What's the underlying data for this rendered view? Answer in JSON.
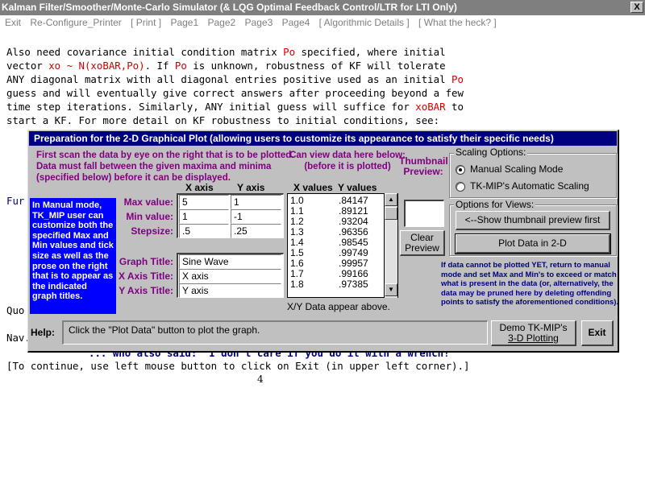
{
  "window": {
    "title": "Kalman Filter/Smoother/Monte-Carlo Simulator (& LQG Optimal Feedback Control/LTR for LTI Only)",
    "close_glyph": "X"
  },
  "menu": {
    "items": [
      "Exit",
      "Re-Configure_Printer",
      "[ Print ]",
      "Page1",
      "Page2",
      "Page3",
      "Page4",
      "[ Algorithmic Details ]",
      "[ What the heck? ]"
    ]
  },
  "document": {
    "line1a": "Also need covariance initial condition matrix ",
    "line1b": "Po",
    "line1c": " specified, where initial",
    "line2a": "vector ",
    "line2b": "xo ~ N(xoBAR,Po)",
    "line2c": ". If ",
    "line2d": "Po",
    "line2e": " is unknown, robustness of KF will tolerate",
    "line3": "ANY diagonal matrix with all diagonal entries positive used as an initial ",
    "line3b": "Po",
    "line4": "guess and will eventually give correct answers after proceeding beyond a few",
    "line5a": "time step iterations. Similarly, ANY initial guess will suffice for ",
    "line5b": "xoBAR",
    "line5c": " to",
    "line6": "start a KF. For more detail on KF robustness to initial conditions, see:",
    "frag_fur": "Fur",
    "frag_quo": "Quo",
    "frag_nav": "Nav.",
    "hidden_line": "... who also said: \"I don't care if you do it with a wrench!\"",
    "continue_line": "[To continue, use left mouse button to click on Exit (in upper left corner).]",
    "page_number": "4"
  },
  "dialog": {
    "title": "Preparation for the 2-D Graphical Plot  (allowing users to customize its appearance to satisfy their specific needs)",
    "intro_text": "First scan the data by eye on the right that is to be plotted. Data must fall between the given maxima and minima (specified below) before it can be displayed.",
    "can_view_text": "Can view data here below:\n(before it is  plotted)",
    "manual_note": "In Manual mode, TK_MIP user can customize both the specified Max and Min values and tick size as well as the  prose on the right that is to appear as the indicated graph titles.",
    "col_x_axis": "X axis",
    "col_y_axis": "Y axis",
    "max_label": "Max value:",
    "min_label": "Min value:",
    "step_label": "Stepsize:",
    "max_x": "5",
    "max_y": "1",
    "min_x": "1",
    "min_y": "-1",
    "step_x": ".5",
    "step_y": ".25",
    "graph_title_label": "Graph Title:",
    "x_axis_title_label": "X Axis Title:",
    "y_axis_title_label": "Y Axis Title:",
    "graph_title_value": "Sine Wave",
    "x_axis_title_value": "X axis",
    "y_axis_title_value": "Y axis",
    "data_hdr_x": "X values",
    "data_hdr_y": "Y values",
    "data_rows": [
      {
        "x": "1.0",
        "y": ".84147"
      },
      {
        "x": "1.1",
        "y": ".89121"
      },
      {
        "x": "1.2",
        "y": ".93204"
      },
      {
        "x": "1.3",
        "y": ".96356"
      },
      {
        "x": "1.4",
        "y": ".98545"
      },
      {
        "x": "1.5",
        "y": ".99749"
      },
      {
        "x": "1.6",
        "y": ".99957"
      },
      {
        "x": "1.7",
        "y": ".99166"
      },
      {
        "x": "1.8",
        "y": ".97385"
      }
    ],
    "data_note": "X/Y Data appear above.",
    "thumbnail_label": "Thumbnail\nPreview:",
    "clear_preview_label": "Clear\nPreview",
    "scaling_group_label": "Scaling Options:",
    "manual_scaling_label": "Manual Scaling Mode",
    "auto_scaling_label": "TK-MIP's Automatic Scaling",
    "views_group_label": "Options for Views:",
    "thumb_button_label": "<--Show thumbnail preview first",
    "plot_button_label": "Plot Data in 2-D",
    "warning_text": "If data cannot be plotted YET, return to manual mode and set Max and Min's to exceed or match what is present in the data (or, alternatively, the data may be pruned here by deleting offending points to satisfy the aforementioned conditions).",
    "help_label": "Help:",
    "help_text": "Click the \"Plot Data\" button to plot the graph.",
    "demo_button_line1": "Demo TK-MIP's",
    "demo_button_line2": "3-D Plotting",
    "exit_button_label": "Exit",
    "scroll_up_glyph": "▲",
    "scroll_down_glyph": "▼"
  }
}
